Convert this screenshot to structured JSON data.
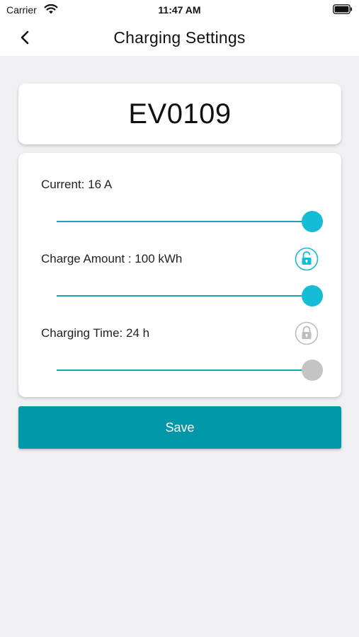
{
  "status_bar": {
    "carrier": "Carrier",
    "time": "11:47 AM"
  },
  "nav": {
    "title": "Charging Settings"
  },
  "device": {
    "id": "EV0109"
  },
  "settings": [
    {
      "label": "Current: 16 A",
      "slider_fraction": 1.0,
      "enabled": true,
      "lock": null
    },
    {
      "label": "Charge Amount : 100 kWh",
      "slider_fraction": 1.0,
      "enabled": true,
      "lock": "unlocked"
    },
    {
      "label": "Charging Time: 24 h",
      "slider_fraction": 1.0,
      "enabled": false,
      "lock": "locked"
    }
  ],
  "save_label": "Save",
  "colors": {
    "accent": "#15bcd6",
    "track": "#1aa3b8",
    "button": "#0097a8",
    "disabled": "#c4c4c4"
  }
}
